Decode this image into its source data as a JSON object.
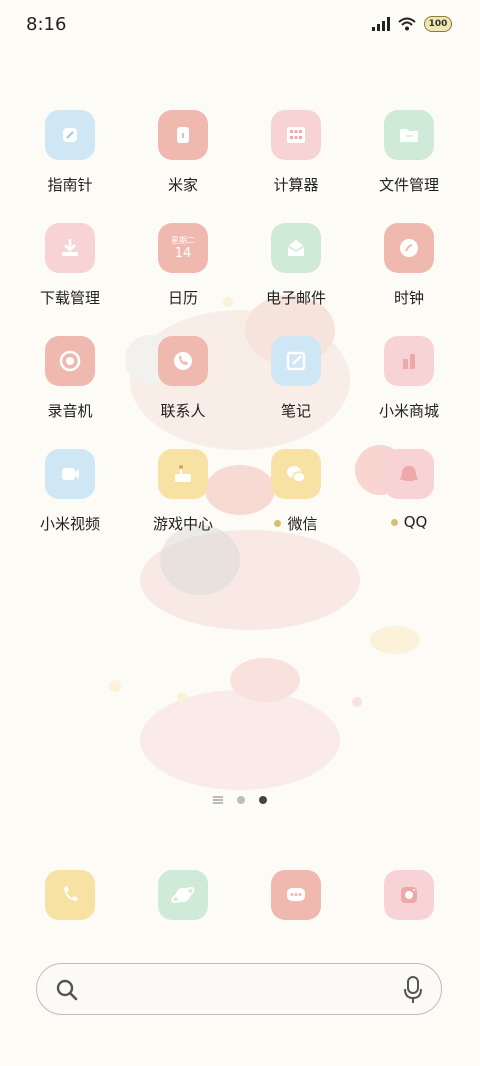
{
  "status_bar": {
    "time": "8:16",
    "battery": "100"
  },
  "apps": [
    {
      "label": "指南针",
      "color": "#cfe6f5",
      "icon": "compass-icon"
    },
    {
      "label": "米家",
      "color": "#efb9b0",
      "icon": "home-device-icon"
    },
    {
      "label": "计算器",
      "color": "#f8d3d5",
      "icon": "calculator-icon"
    },
    {
      "label": "文件管理",
      "color": "#cfead7",
      "icon": "folder-icon"
    },
    {
      "label": "下载管理",
      "color": "#f8d3d5",
      "icon": "download-icon"
    },
    {
      "label": "日历",
      "color": "#efb9b0",
      "icon": "calendar-icon",
      "calendar_weekday": "星期二",
      "calendar_day": "14"
    },
    {
      "label": "电子邮件",
      "color": "#cfead7",
      "icon": "mail-icon"
    },
    {
      "label": "时钟",
      "color": "#efb9b0",
      "icon": "clock-icon"
    },
    {
      "label": "录音机",
      "color": "#efb9b0",
      "icon": "recorder-icon"
    },
    {
      "label": "联系人",
      "color": "#efb9b0",
      "icon": "contacts-icon"
    },
    {
      "label": "笔记",
      "color": "#cfe6f5",
      "icon": "notes-icon"
    },
    {
      "label": "小米商城",
      "color": "#f8d3d5",
      "icon": "mall-icon"
    },
    {
      "label": "小米视频",
      "color": "#cfe6f5",
      "icon": "video-icon"
    },
    {
      "label": "游戏中心",
      "color": "#f7e2a3",
      "icon": "game-icon"
    },
    {
      "label": "微信",
      "color": "#f7e2a3",
      "icon": "wechat-icon",
      "new_dot": true
    },
    {
      "label": "QQ",
      "color": "#f8d3d5",
      "icon": "qq-icon",
      "new_dot": true
    }
  ],
  "dock": [
    {
      "name": "phone",
      "color": "#f7e2a3",
      "icon": "phone-icon"
    },
    {
      "name": "browser",
      "color": "#cfead7",
      "icon": "planet-icon"
    },
    {
      "name": "messages",
      "color": "#efb9b0",
      "icon": "message-icon"
    },
    {
      "name": "camera",
      "color": "#f8d3d5",
      "icon": "camera-icon"
    }
  ],
  "pager": {
    "pages": 2,
    "active_index": 1
  },
  "search": {
    "placeholder": ""
  }
}
